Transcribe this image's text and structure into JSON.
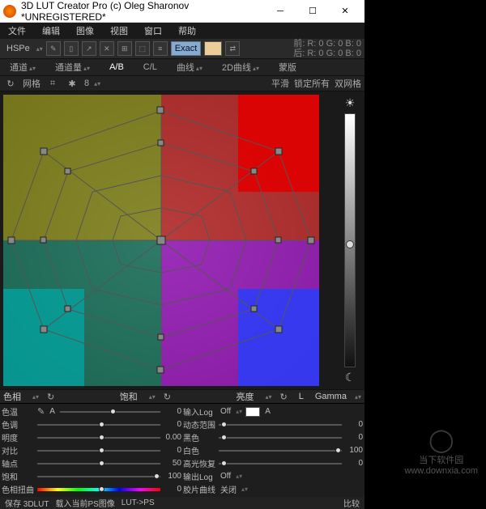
{
  "title": "3D LUT Creator Pro (c) Oleg Sharonov *UNREGISTERED*",
  "menu": {
    "file": "文件",
    "edit": "编辑",
    "image": "图像",
    "view": "视图",
    "window": "窗口",
    "help": "帮助"
  },
  "toolbar1": {
    "mode": "HSPe",
    "exact": "Exact",
    "rgb_front": "前: R: 0 G: 0 B: 0",
    "rgb_back": "后: R: 0 G: 0 B: 0"
  },
  "toolbar2": {
    "channels": "通道",
    "chanqty": "通道量",
    "ab": "A/B",
    "cl": "C/L",
    "curves": "曲线",
    "curves2d": "2D曲线",
    "mask": "蒙版"
  },
  "toolbar3": {
    "grid": "网格",
    "gridn": "8",
    "flat": "平滑",
    "lockall": "锁定所有",
    "dblgrid": "双网格"
  },
  "hsl": {
    "hue": "色相",
    "sat": "饱和",
    "light": "亮度",
    "lmode": "L",
    "gamma": "Gamma"
  },
  "left_sliders": [
    {
      "label": "色温",
      "val": "0"
    },
    {
      "label": "色调",
      "val": "0"
    },
    {
      "label": "明度",
      "val": "0.00"
    },
    {
      "label": "对比",
      "val": "0"
    },
    {
      "label": "轴点",
      "val": "50"
    },
    {
      "label": "饱和",
      "val": "100"
    },
    {
      "label": "色相扭曲",
      "val": "0"
    }
  ],
  "right_sliders": [
    {
      "label": "输入Log",
      "sel": "Off",
      "val": ""
    },
    {
      "label": "动态范围",
      "sel": "",
      "val": "0"
    },
    {
      "label": "黑色",
      "sel": "",
      "val": "0"
    },
    {
      "label": "白色",
      "sel": "",
      "val": "100"
    },
    {
      "label": "高光恢复",
      "sel": "",
      "val": "0"
    },
    {
      "label": "输出Log",
      "sel": "Off",
      "val": ""
    },
    {
      "label": "胶片曲线",
      "sel": "关闭",
      "val": ""
    }
  ],
  "right_extras": {
    "a_label": "A"
  },
  "bottombar": {
    "save": "保存 3DLUT",
    "load": "载入当前PS图像",
    "lutps": "LUT->PS",
    "compare": "比较"
  },
  "watermark": {
    "name": "当下软件园",
    "url": "www.downxia.com"
  }
}
